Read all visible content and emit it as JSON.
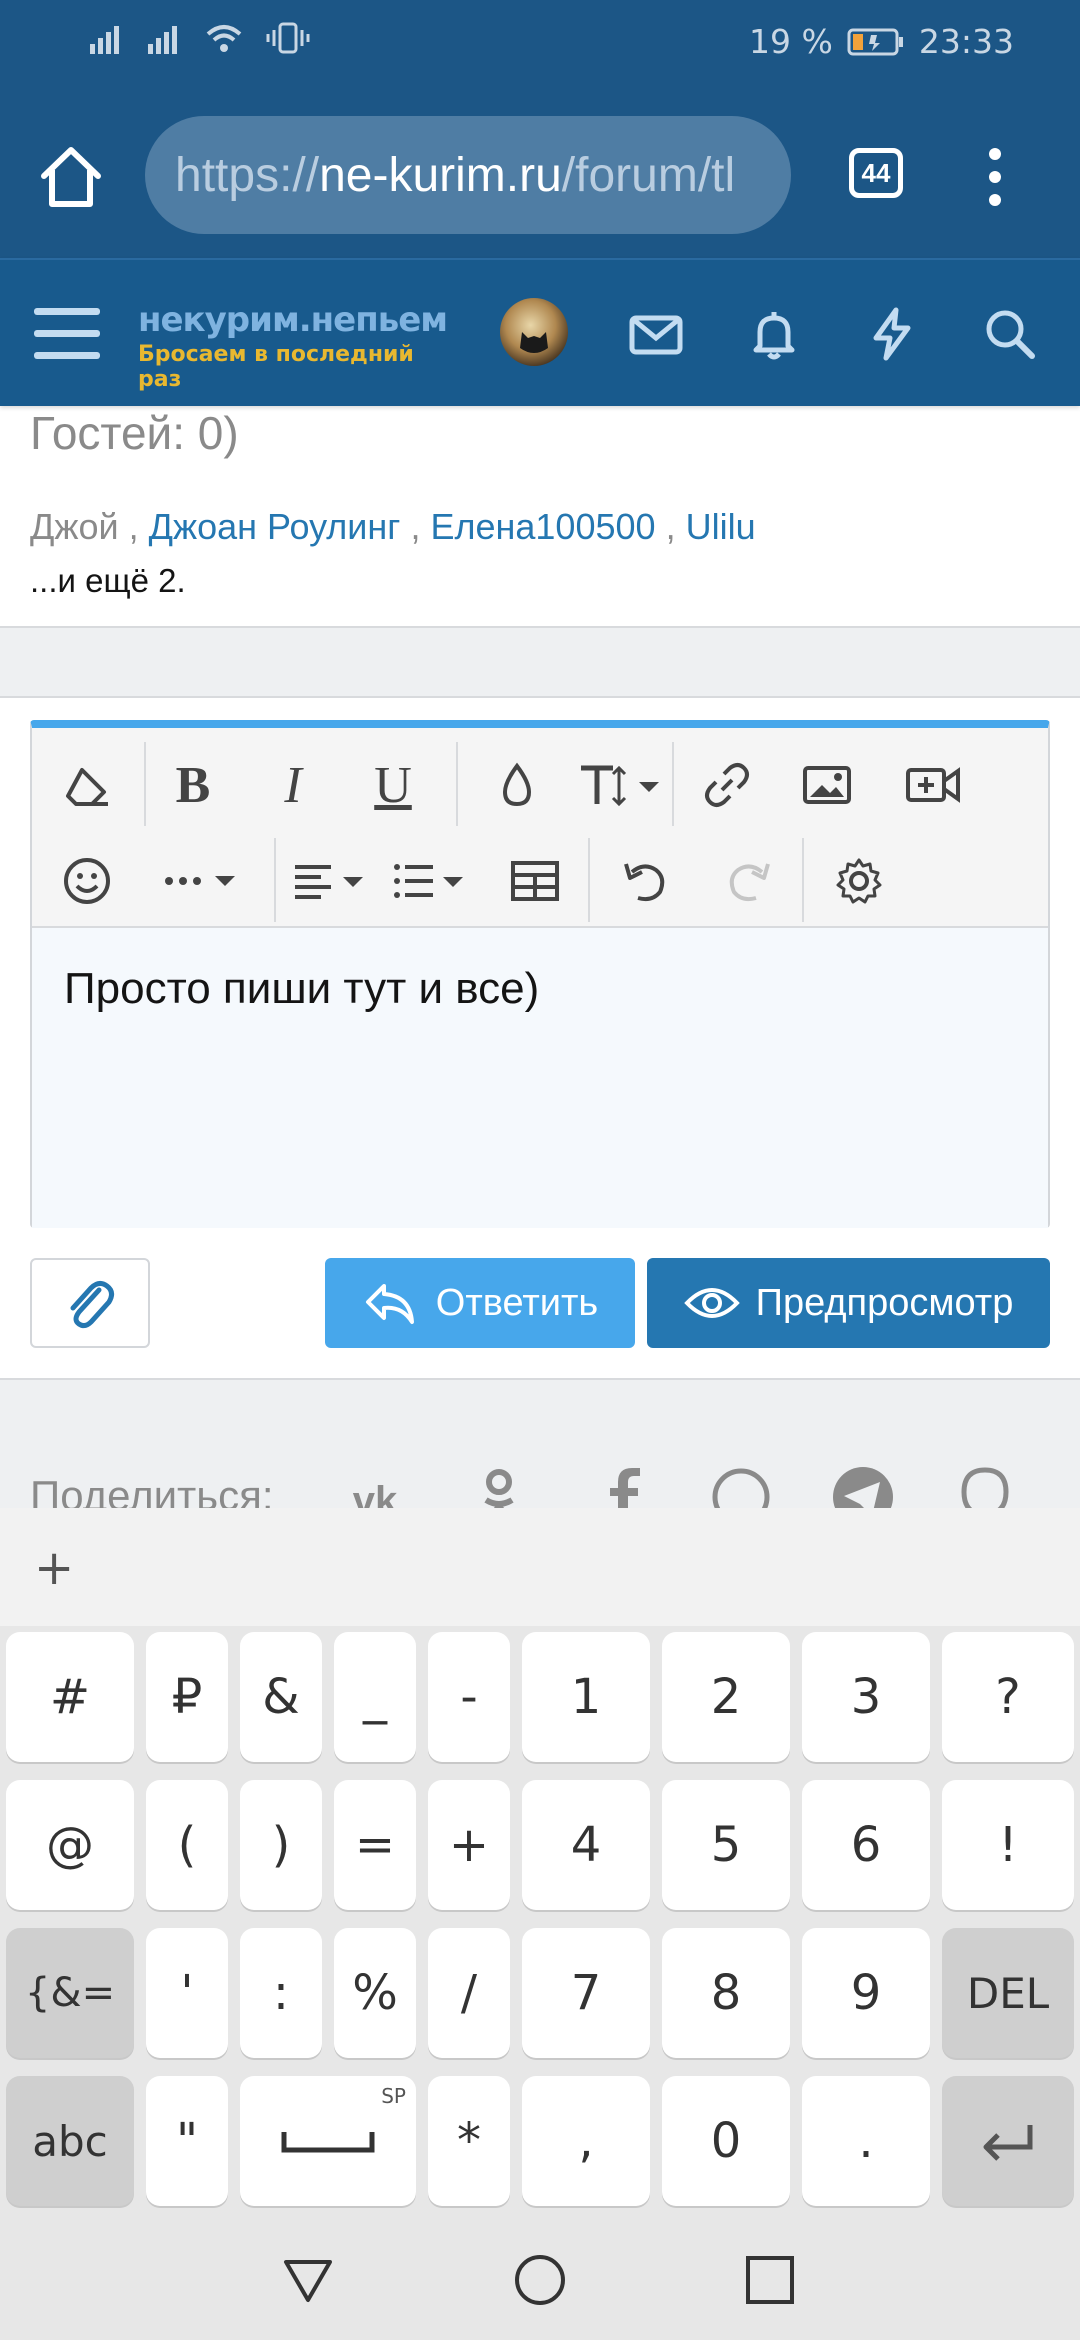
{
  "status_bar": {
    "battery_percent": "19 %",
    "time": "23:33"
  },
  "browser": {
    "url_scheme": "https://",
    "url_host": "ne-kurim.ru",
    "url_path": "/forum/tl",
    "tab_count": "44"
  },
  "site": {
    "logo_line1": "некурим.непьем",
    "logo_line2": "Бросаем в последний раз"
  },
  "online": {
    "guests_text": "Гостей: 0)",
    "user_plain": "Джой",
    "sep": ",",
    "users": [
      "Джоан Роулинг",
      "Елена100500",
      "Ulilu"
    ],
    "more_text": "...и ещё 2."
  },
  "editor": {
    "content": "Просто пиши тут и все)"
  },
  "actions": {
    "reply_label": "Ответить",
    "preview_label": "Предпросмотр"
  },
  "share": {
    "label": "Поделиться:"
  },
  "keyboard": {
    "rows": [
      [
        "#",
        "₽",
        "&",
        "_",
        "-",
        "1",
        "2",
        "3",
        "?"
      ],
      [
        "@",
        "(",
        ")",
        "=",
        "+",
        "4",
        "5",
        "6",
        "!"
      ],
      [
        "{&=",
        "'",
        ":",
        "%",
        "/",
        "7",
        "8",
        "9",
        "DEL"
      ],
      [
        "abc",
        "\"",
        "",
        "*",
        ",",
        "0",
        ".",
        ""
      ]
    ],
    "space_hint": "SP",
    "plus": "+"
  },
  "colors": {
    "header_blue": "#1c5686",
    "link_blue": "#2577b1",
    "reply_blue": "#47a7eb",
    "logo_yellow": "#e8b830"
  }
}
